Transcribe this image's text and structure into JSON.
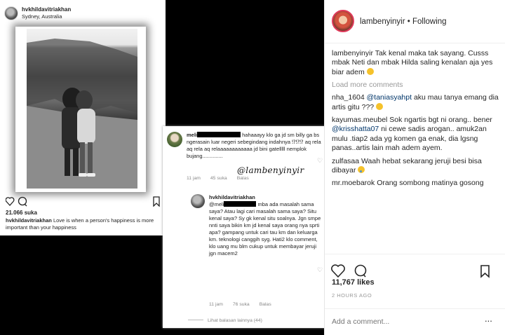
{
  "left_post": {
    "username": "hvkhildavitriakhan",
    "location": "Sydney, Australia",
    "likes": "21.066 suka",
    "caption_user": "hvkhildavitriakhan",
    "caption_text": "Love is when a person's happiness is more important than your happiness"
  },
  "middle": {
    "comment1": {
      "user_prefix": "meli",
      "text": "hahaaayy klo ga jd sm billy ga bs ngerasain luar negeri sebegindang indahnya ⁉⁉⁉ aq rela aq rela aq relaaaaaaaaaaaa jd bini gatelllll nemplok bujang..............",
      "time": "11 jam",
      "likes": "45 suka",
      "reply": "Balas"
    },
    "comment2": {
      "user": "hvkhildavitriakhan",
      "mention_prefix": "@meli",
      "text": "mba ada masalah sama saya? Atau lagi cari masalah sama saya? Situ kenal saya? Sy gk kenal situ soalnya. Jgn smpe nnti saya bikin km jd kenal saya orang nya sprti apa? gampang untuk cari tau km dan keluarga km. teknologi canggih syg. Hati2 klo comment, klo uang mu blm cukup untuk membayar jeruji jgn macem2",
      "time": "11 jam",
      "likes": "76 suka",
      "reply": "Balas"
    },
    "view_replies": "Lihat balasan lainnya (44)",
    "watermark": "@lambenyinyir"
  },
  "right": {
    "username": "lambenyinyir",
    "following": "• Following",
    "caption_user": "lambenyinyir",
    "caption_text": "Tak kenal maka tak sayang. Cusss mbak Neti dan mbak Hilda saling kenalan aja yes biar adem",
    "load_more": "Load more comments",
    "comments": [
      {
        "user": "nha_1604",
        "mention": "@taniasyahpt",
        "text": "aku mau tanya emang dia artis gitu ???"
      },
      {
        "user": "kayumas.meubel",
        "text": "Sok ngartis bgt ni orang.. bener",
        "mention": "@krisshatta07",
        "text2": "ni cewe sadis arogan.. amuk2an mulu .tiap2 ada yg komen ga enak, dia lgsng panas..artis lain mah adem ayem."
      },
      {
        "user": "zulfasaa",
        "text": "Waah hebat sekarang jeruji besi bisa dibayar"
      },
      {
        "user": "mr.moebarok",
        "text": "Orang sombong matinya gosong"
      }
    ],
    "likes": "11,767 likes",
    "time": "2 HOURS AGO",
    "add_comment_placeholder": "Add a comment...",
    "more": "..."
  }
}
